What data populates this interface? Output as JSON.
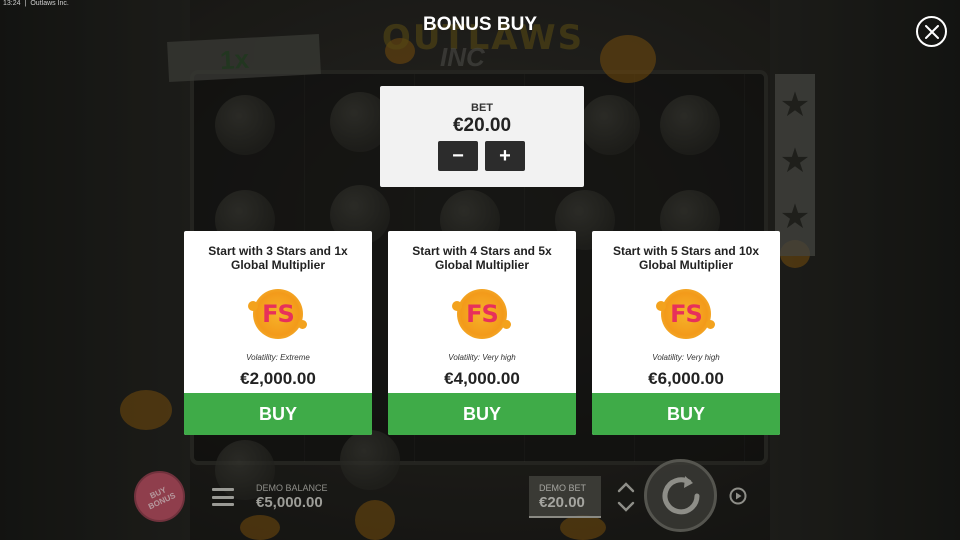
{
  "status_bar": {
    "time": "13:24",
    "app_name": "Outlaws Inc."
  },
  "header": {
    "title": "BONUS BUY"
  },
  "bet_panel": {
    "label": "BET",
    "value": "€20.00",
    "decrease_label": "−",
    "increase_label": "+"
  },
  "options": [
    {
      "title": "Start with 3 Stars and 1x Global Multiplier",
      "badge": "FS",
      "volatility": "Volatility: Extreme",
      "price": "€2,000.00",
      "buy_label": "BUY"
    },
    {
      "title": "Start with 4 Stars and 5x Global Multiplier",
      "badge": "FS",
      "volatility": "Volatility: Very high",
      "price": "€4,000.00",
      "buy_label": "BUY"
    },
    {
      "title": "Start with 5 Stars and 10x Global Multiplier",
      "badge": "FS",
      "volatility": "Volatility: Very high",
      "price": "€6,000.00",
      "buy_label": "BUY"
    }
  ],
  "background": {
    "tape_label": "1x",
    "logo_text": "OUTLAWS",
    "logo_sub": "INC"
  },
  "bottom_bar": {
    "buy_bonus_label": "BUY BONUS",
    "balance_label": "DEMO BALANCE",
    "balance_value": "€5,000.00",
    "bet_label": "DEMO BET",
    "bet_value": "€20.00"
  },
  "colors": {
    "buy_green": "#3fab48",
    "fs_pink": "#e7305b",
    "fs_orange": "#f39a1a",
    "card_bg": "#ffffff",
    "bet_panel_bg": "#f2f2f2"
  },
  "icons": {
    "close": "close-icon",
    "menu": "hamburger-menu-icon",
    "spin": "spin-icon",
    "autoplay": "autoplay-icon",
    "bet_up": "chevron-up-icon",
    "bet_down": "chevron-down-icon"
  }
}
